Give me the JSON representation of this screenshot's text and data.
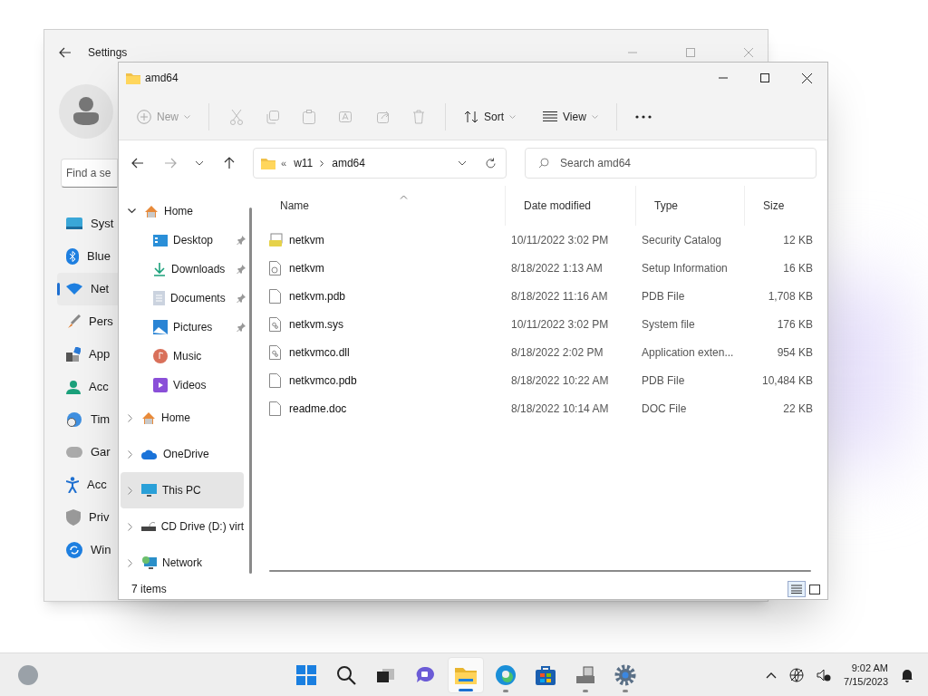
{
  "settings_window": {
    "title": "Settings",
    "search": {
      "placeholder": "Find a se"
    },
    "nav": [
      {
        "label": "Syst",
        "selected": false
      },
      {
        "label": "Blue",
        "selected": false
      },
      {
        "label": "Net",
        "selected": true
      },
      {
        "label": "Pers",
        "selected": false
      },
      {
        "label": "App",
        "selected": false
      },
      {
        "label": "Acc",
        "selected": false
      },
      {
        "label": "Tim",
        "selected": false
      },
      {
        "label": "Gar",
        "selected": false
      },
      {
        "label": "Acc",
        "selected": false
      },
      {
        "label": "Priv",
        "selected": false
      },
      {
        "label": "Win",
        "selected": false
      }
    ]
  },
  "explorer": {
    "title": "amd64",
    "toolbar": [
      {
        "label": "New",
        "disabled": true
      },
      {
        "label": "Sort",
        "disabled": false
      },
      {
        "label": "View",
        "disabled": false
      }
    ],
    "breadcrumb": {
      "overflow": "«",
      "parts": [
        "w11",
        "amd64"
      ]
    },
    "search": {
      "placeholder": "Search amd64"
    },
    "nav_tree": [
      {
        "label": "Home",
        "expanded": true,
        "selected": false,
        "children": [
          {
            "label": "Desktop",
            "pinned": true
          },
          {
            "label": "Downloads",
            "pinned": true
          },
          {
            "label": "Documents",
            "pinned": true
          },
          {
            "label": "Pictures",
            "pinned": true
          },
          {
            "label": "Music",
            "pinned": false
          },
          {
            "label": "Videos",
            "pinned": false
          }
        ]
      },
      {
        "label": "Home",
        "expanded": false,
        "selected": false
      },
      {
        "label": "OneDrive",
        "expanded": false,
        "selected": false
      },
      {
        "label": "This PC",
        "expanded": false,
        "selected": true
      },
      {
        "label": "CD Drive (D:) virt",
        "expanded": false,
        "selected": false
      },
      {
        "label": "Network",
        "expanded": false,
        "selected": false
      }
    ],
    "columns": [
      "Name",
      "Date modified",
      "Type",
      "Size"
    ],
    "rows": [
      {
        "kind": "catalog",
        "name": "netkvm",
        "date": "10/11/2022 3:02 PM",
        "type": "Security Catalog",
        "size": "12 KB"
      },
      {
        "kind": "setup",
        "name": "netkvm",
        "date": "8/18/2022 1:13 AM",
        "type": "Setup Information",
        "size": "16 KB"
      },
      {
        "kind": "file",
        "name": "netkvm.pdb",
        "date": "8/18/2022 11:16 AM",
        "type": "PDB File",
        "size": "1,708 KB"
      },
      {
        "kind": "system",
        "name": "netkvm.sys",
        "date": "10/11/2022 3:02 PM",
        "type": "System file",
        "size": "176 KB"
      },
      {
        "kind": "system",
        "name": "netkvmco.dll",
        "date": "8/18/2022 2:02 PM",
        "type": "Application exten...",
        "size": "954 KB"
      },
      {
        "kind": "file",
        "name": "netkvmco.pdb",
        "date": "8/18/2022 10:22 AM",
        "type": "PDB File",
        "size": "10,484 KB"
      },
      {
        "kind": "file",
        "name": "readme.doc",
        "date": "8/18/2022 10:14 AM",
        "type": "DOC File",
        "size": "22 KB"
      }
    ],
    "status": "7 items"
  },
  "taskbar": {
    "apps": [
      {
        "running": false,
        "active": false
      },
      {
        "running": false,
        "active": false
      },
      {
        "running": false,
        "active": false
      },
      {
        "running": false,
        "active": false
      },
      {
        "running": true,
        "active": true
      },
      {
        "running": true,
        "active": false
      },
      {
        "running": false,
        "active": false
      },
      {
        "running": true,
        "active": false
      },
      {
        "running": true,
        "active": false
      }
    ],
    "time": "9:02 AM",
    "date": "7/15/2023"
  }
}
